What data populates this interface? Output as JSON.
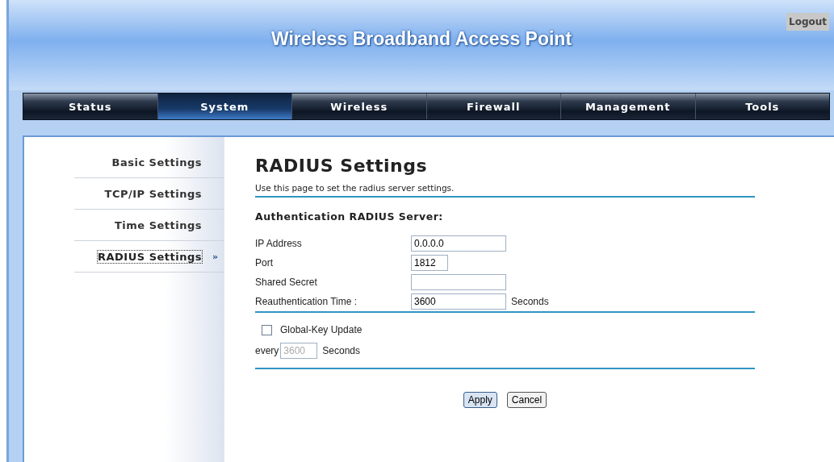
{
  "header": {
    "title": "Wireless Broadband Access Point",
    "logout": "Logout"
  },
  "tabs": [
    {
      "label": "Status",
      "selected": false
    },
    {
      "label": "System",
      "selected": true
    },
    {
      "label": "Wireless",
      "selected": false
    },
    {
      "label": "Firewall",
      "selected": false
    },
    {
      "label": "Management",
      "selected": false
    },
    {
      "label": "Tools",
      "selected": false
    }
  ],
  "sidebar": {
    "items": [
      {
        "label": "Basic Settings",
        "selected": false
      },
      {
        "label": "TCP/IP Settings",
        "selected": false
      },
      {
        "label": "Time Settings",
        "selected": false
      },
      {
        "label": "RADIUS Settings",
        "selected": true,
        "marker": "»"
      }
    ]
  },
  "page": {
    "title": "RADIUS Settings",
    "description": "Use this page to set the radius server settings.",
    "section": "Authentication RADIUS Server:",
    "fields": [
      {
        "label": "IP Address",
        "value": "0.0.0.0",
        "kind": "long"
      },
      {
        "label": "Port",
        "value": "1812",
        "kind": "short"
      },
      {
        "label": "Shared Secret",
        "kind": "long"
      },
      {
        "label": "Reauthentication Time :",
        "value": "3600",
        "kind": "long",
        "suffix": "Seconds"
      }
    ],
    "global_key": {
      "label": "Global-Key Update",
      "checked": false,
      "prefix": "every",
      "value": "3600",
      "suffix": "Seconds",
      "disabled": true
    },
    "buttons": [
      {
        "label": "Apply",
        "kind": "primary"
      },
      {
        "label": "Cancel",
        "kind": "secondary"
      }
    ]
  }
}
